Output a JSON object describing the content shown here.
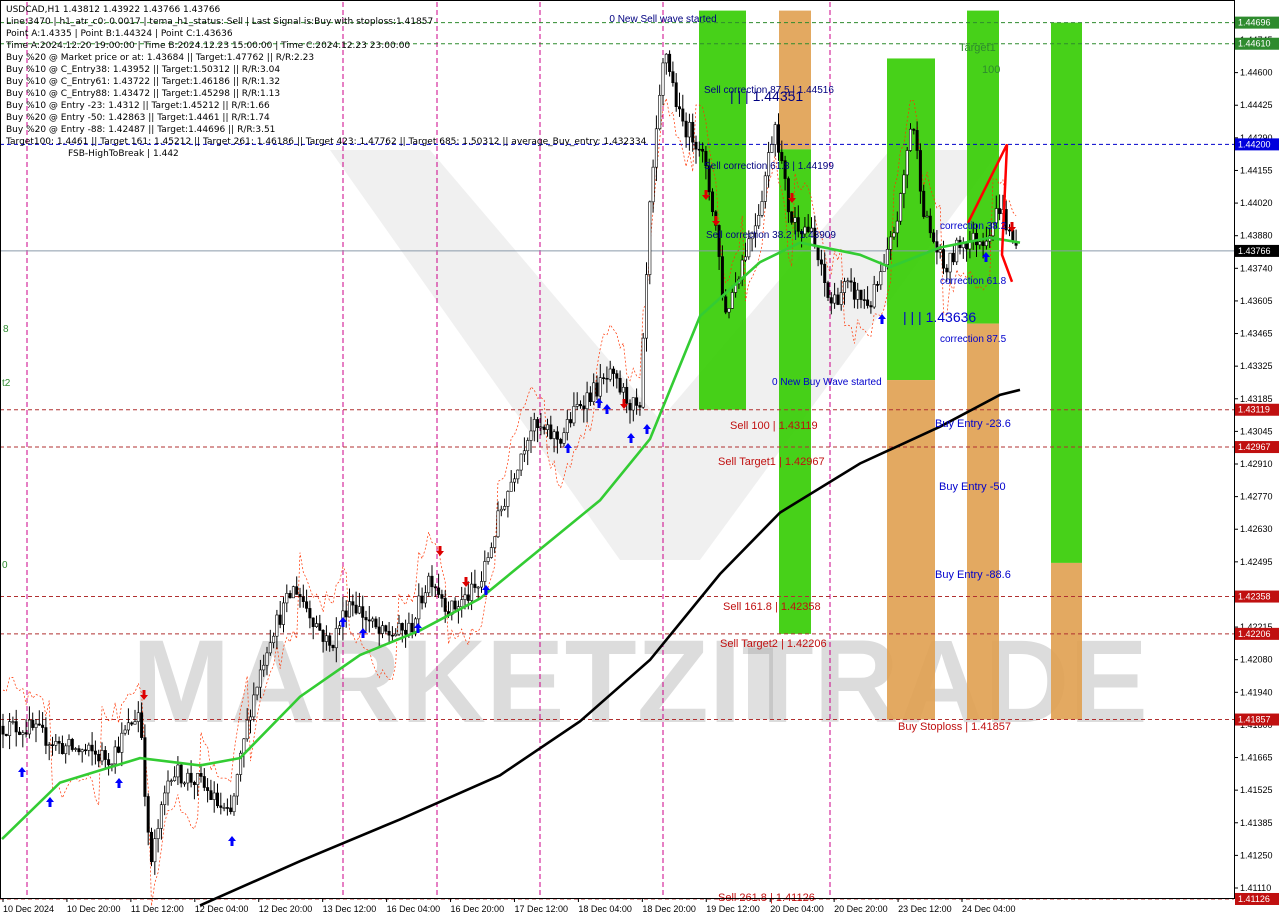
{
  "header": {
    "symbol_line": "USDCAD,H1  1.43812 1.43922 1.43766 1.43766",
    "lines": [
      "Line:3470 | h1_atr_c0: 0.0017 | tema_h1_status: Sell | Last Signal is:Buy with stoploss:1.41857",
      "Point A:1.4335 | Point B:1.44324 | Point C:1.43636",
      "Time A:2024.12.20 19:00:00 | Time B:2024.12.23 15:00:00 | Time C:2024.12.23 23:00:00",
      "Buy %20 @ Market price or at: 1.43684 || Target:1.47762 || R/R:2.23",
      "Buy %10 @ C_Entry38: 1.43952 || Target:1.50312 || R/R:3.04",
      "Buy %10 @ C_Entry61: 1.43722 || Target:1.46186 || R/R:1.32",
      "Buy %10 @ C_Entry88: 1.43472 || Target:1.45298 || R/R:1.13",
      "Buy %10 @ Entry -23: 1.4312 || Target:1.45212 || R/R:1.66",
      "Buy %20 @ Entry -50: 1.42863 || Target:1.4461 || R/R:1.74",
      "Buy %20 @ Entry -88: 1.42487 || Target:1.44696 || R/R:3.51",
      "Target100: 1.4461 || Target 161: 1.45212 || Target 261: 1.46186 || Target 423: 1.47762 || Target 685: 1.50312 || average_Buy_entry: 1.432334",
      "FSB-HighToBreak | 1.442"
    ]
  },
  "chart_data": {
    "type": "candlestick",
    "symbol": "USDCAD",
    "timeframe": "H1",
    "ylim": [
      1.4113,
      1.4478
    ],
    "y_ticks": [
      "1.44745",
      "1.44600",
      "1.44425",
      "1.44290",
      "1.44155",
      "1.44020",
      "1.43880",
      "1.43740",
      "1.43605",
      "1.43465",
      "1.43325",
      "1.43185",
      "1.43045",
      "1.42910",
      "1.42770",
      "1.42630",
      "1.42495",
      "1.42355",
      "1.42215",
      "1.42080",
      "1.41940",
      "1.41800",
      "1.41665",
      "1.41525",
      "1.41385",
      "1.41250",
      "1.41110"
    ],
    "x_ticks": [
      "10 Dec 2024",
      "10 Dec 20:00",
      "11 Dec 12:00",
      "12 Dec 04:00",
      "12 Dec 20:00",
      "13 Dec 12:00",
      "16 Dec 04:00",
      "16 Dec 20:00",
      "17 Dec 12:00",
      "18 Dec 04:00",
      "18 Dec 20:00",
      "19 Dec 12:00",
      "20 Dec 04:00",
      "20 Dec 20:00",
      "23 Dec 12:00",
      "24 Dec 04:00"
    ],
    "current_price": "1.43766",
    "price_levels": [
      {
        "value": 1.44696,
        "label": "1.44696",
        "color": "#2e8b2e",
        "line": "#2e8b2e",
        "style": "dashed"
      },
      {
        "value": 1.4461,
        "label": "1.44610",
        "color": "#2e8b2e",
        "line": "#2e8b2e",
        "style": "dashed"
      },
      {
        "value": 1.442,
        "label": "1.44200",
        "color": "#0000dd",
        "line": "#0000cc",
        "style": "dashed"
      },
      {
        "value": 1.43766,
        "label": "1.43766",
        "color": "#000000",
        "line": "#8a9aaa",
        "style": "solid"
      },
      {
        "value": 1.43119,
        "label": "1.43119",
        "color": "#c01010",
        "line": "#b03030",
        "style": "dashed"
      },
      {
        "value": 1.42967,
        "label": "1.42967",
        "color": "#c01010",
        "line": "#b03030",
        "style": "dashed"
      },
      {
        "value": 1.42358,
        "label": "1.42358",
        "color": "#c01010",
        "line": "#b03030",
        "style": "dashed"
      },
      {
        "value": 1.42206,
        "label": "1.42206",
        "color": "#c01010",
        "line": "#b03030",
        "style": "dashed"
      },
      {
        "value": 1.41857,
        "label": "1.41857",
        "color": "#c01010",
        "line": "#b03030",
        "style": "dashed"
      },
      {
        "value": 1.41126,
        "label": "1.41126",
        "color": "#c01010",
        "line": "#b03030",
        "style": "dashed"
      }
    ],
    "annotations": [
      {
        "text": "0 New Sell wave started",
        "color": "#000080",
        "x": 663,
        "y": 22,
        "anchor": "middle"
      },
      {
        "text": "Sell correction 87.5 | 1.44516",
        "color": "#000080",
        "x": 704,
        "y": 93,
        "anchor": "start"
      },
      {
        "text": "| | | 1.44351",
        "color": "#000080",
        "x": 730,
        "y": 101,
        "anchor": "start",
        "size": 14
      },
      {
        "text": "Sell correction 61.8 | 1.44199",
        "color": "#000080",
        "x": 704,
        "y": 169,
        "anchor": "start"
      },
      {
        "text": "Sell correction 38.2 | 1.43909",
        "color": "#000080",
        "x": 706,
        "y": 238,
        "anchor": "start"
      },
      {
        "text": "0 New Buy Wave started",
        "color": "#0000cc",
        "x": 772,
        "y": 385,
        "anchor": "start"
      },
      {
        "text": "Sell 100 | 1.43119",
        "color": "#c01010",
        "x": 730,
        "y": 429,
        "anchor": "start",
        "size": 11
      },
      {
        "text": "Sell Target1 | 1.42967",
        "color": "#c01010",
        "x": 718,
        "y": 465,
        "anchor": "start",
        "size": 11
      },
      {
        "text": "Sell 161.8 | 1.42358",
        "color": "#c01010",
        "x": 723,
        "y": 610,
        "anchor": "start",
        "size": 11
      },
      {
        "text": "Sell Target2 | 1.42206",
        "color": "#c01010",
        "x": 720,
        "y": 647,
        "anchor": "start",
        "size": 11
      },
      {
        "text": "Sell 261.8 | 1.41126",
        "color": "#c01010",
        "x": 718,
        "y": 901,
        "anchor": "start",
        "size": 11
      },
      {
        "text": "Target1",
        "color": "#2e8b2e",
        "x": 959,
        "y": 51,
        "anchor": "start",
        "size": 11
      },
      {
        "text": "100",
        "color": "#2e8b2e",
        "x": 982,
        "y": 73,
        "anchor": "start",
        "size": 11
      },
      {
        "text": "correction 38.2",
        "color": "#0000cc",
        "x": 940,
        "y": 229,
        "anchor": "start"
      },
      {
        "text": "correction 61.8",
        "color": "#0000cc",
        "x": 940,
        "y": 284,
        "anchor": "start"
      },
      {
        "text": "| | | 1.43636",
        "color": "#0000cc",
        "x": 903,
        "y": 322,
        "anchor": "start",
        "size": 14
      },
      {
        "text": "correction 87.5",
        "color": "#0000cc",
        "x": 940,
        "y": 342,
        "anchor": "start"
      },
      {
        "text": "Buy Entry -23.6",
        "color": "#0000cc",
        "x": 935,
        "y": 427,
        "anchor": "start",
        "size": 11
      },
      {
        "text": "Buy Entry -50",
        "color": "#0000cc",
        "x": 939,
        "y": 490,
        "anchor": "start",
        "size": 11
      },
      {
        "text": "Buy Entry -88.6",
        "color": "#0000cc",
        "x": 935,
        "y": 578,
        "anchor": "start",
        "size": 11
      },
      {
        "text": "Buy Stoploss | 1.41857",
        "color": "#c01010",
        "x": 898,
        "y": 730,
        "anchor": "start",
        "size": 11
      },
      {
        "text": "8",
        "color": "#2e8b2e",
        "x": 3,
        "y": 332,
        "anchor": "start"
      },
      {
        "text": "t2",
        "color": "#2e8b2e",
        "x": 2,
        "y": 386,
        "anchor": "start"
      },
      {
        "text": "0",
        "color": "#2e8b2e",
        "x": 2,
        "y": 568,
        "anchor": "start"
      }
    ],
    "watermark": "MARKETZITRADE",
    "colors": {
      "ma_fast": "#33cc33",
      "ma_slow": "#000000",
      "stop_line": "#ff3300",
      "buy_arrow": "#0000ff",
      "sell_arrow": "#dd0000"
    }
  }
}
